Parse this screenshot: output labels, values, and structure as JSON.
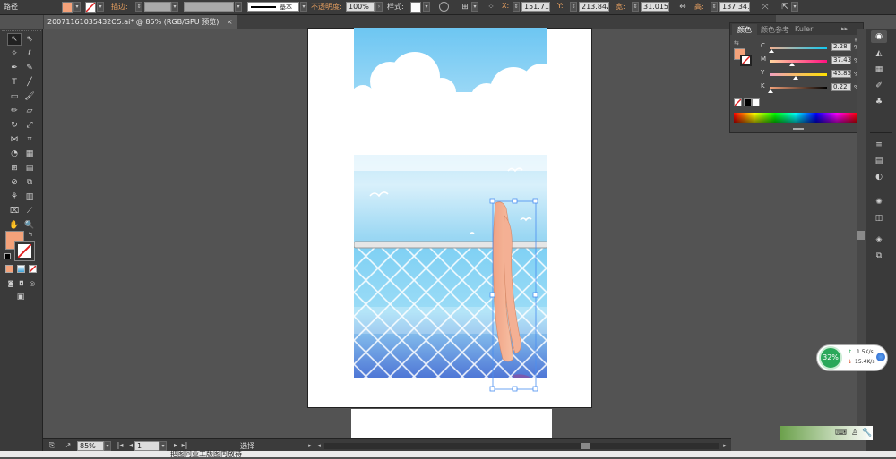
{
  "control_bar": {
    "object_type": "路径",
    "stroke_label": "描边:",
    "stroke_profile": "基本",
    "opacity_label": "不透明度:",
    "opacity_value": "100%",
    "style_label": "样式:",
    "x_label": "X:",
    "x_value": "151.716",
    "y_label": "Y:",
    "y_value": "213.842",
    "w_label": "宽:",
    "w_value": "31.015",
    "h_label": "高:",
    "h_value": "137.341",
    "fill_color": "#f4a27a",
    "accent_orange": "#e8a060"
  },
  "document": {
    "tab_title": "20071161035432O5.ai* @ 85% (RGB/GPU 预览)",
    "close_symbol": "×"
  },
  "tools": {
    "fill_color": "#f4a27a",
    "stroke_color": "none"
  },
  "color_panel": {
    "tabs": [
      "颜色",
      "颜色参考",
      "Kuler"
    ],
    "menu_symbol": "≡",
    "collapse_symbol": "▸▸",
    "sliders": [
      {
        "label": "C",
        "value": "2.28",
        "unit": "%",
        "level": 0.023,
        "gradient": "linear-gradient(to right,#f4b090,#10c8f0)"
      },
      {
        "label": "M",
        "value": "37.43",
        "unit": "%",
        "level": 0.374,
        "gradient": "linear-gradient(to right,#ffd8a0,#ff1080)"
      },
      {
        "label": "Y",
        "value": "43.85",
        "unit": "%",
        "level": 0.4385,
        "gradient": "linear-gradient(to right,#f0a0c0,#ffe000)"
      },
      {
        "label": "K",
        "value": "0.22",
        "unit": "%",
        "level": 0.0022,
        "gradient": "linear-gradient(to right,#f4a27a,#000000)"
      }
    ],
    "current_fill": "#f4a27a"
  },
  "status_bar": {
    "zoom": "85%",
    "artboard_number": "1",
    "tool_name": "选择"
  },
  "network_widget": {
    "percent": "32%",
    "upload": "1.5K/s",
    "download": "15.4K/s",
    "up_arrow": "↑",
    "down_arrow": "↓"
  },
  "page_footer_text": "把图问业工版图内放待"
}
